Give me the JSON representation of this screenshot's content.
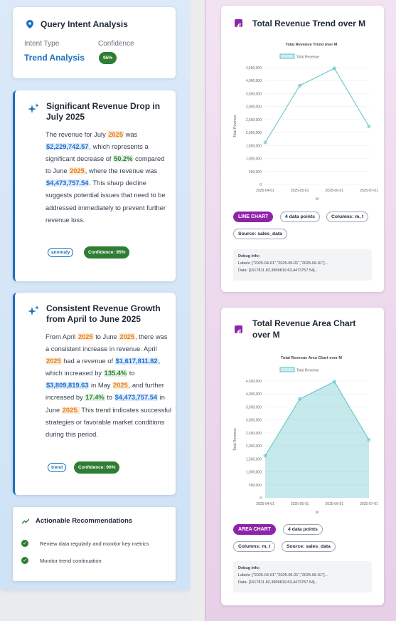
{
  "query_intent": {
    "title": "Query Intent Analysis",
    "intent_type_label": "Intent Type",
    "intent_type_value": "Trend Analysis",
    "confidence_label": "Confidence",
    "confidence_value": "95%"
  },
  "insight1": {
    "title": "Significant Revenue Drop in July 2025",
    "t1": "The revenue for July ",
    "h1": "2025",
    "t2": " was ",
    "h2": "$2,229,742.57",
    "t3": ", which represents a significant decrease of ",
    "h3": "50.2%",
    "t4": " compared to June ",
    "h4": "2025",
    "t5": ", where the revenue was ",
    "h5": "$4,473,757.54",
    "t6": ". This sharp decline suggests potential issues that need to be addressed immediately to prevent further revenue loss.",
    "tag": "anomaly",
    "confidence": "Confidence: 95%"
  },
  "insight2": {
    "title": "Consistent Revenue Growth from April to June 2025",
    "t1": "From April ",
    "h1": "2025",
    "t2": " to June ",
    "h2": "2025",
    "t3": ", there was a consistent increase in revenue. April ",
    "h3": "2025",
    "t4": " had a revenue of ",
    "h4": "$1,617,811.82",
    "t5": ", which increased by ",
    "h5": "135.4%",
    "t6": " to ",
    "h6": "$3,809,819.63",
    "t7": " in May ",
    "h7": "2025",
    "t8": ", and further increased by ",
    "h8": "17.4%",
    "t9": " to ",
    "h9": "$4,473,757.54",
    "t10": " in June ",
    "h10": "2025.",
    "t11": " This trend indicates successful strategies or favorable market conditions during this period.",
    "tag": "trend",
    "confidence": "Confidence: 90%"
  },
  "recommendations": {
    "title": "Actionable Recommendations",
    "items": [
      "Review data regularly and monitor key metrics",
      "Monitor trend continuation"
    ]
  },
  "chart1_card": {
    "title": "Total Revenue Trend over M",
    "tag_type": "LINE CHART",
    "tag_points": "4 data points",
    "tag_columns": "Columns: m, t",
    "tag_source": "Source: sales_data",
    "debug_title": "Debug Info:",
    "debug_labels": "Labels: [\"2025-04-01\",\"2025-05-01\",\"2025-06-01\"]...",
    "debug_data": "Data: [1617811.82,3809819.63,4473757.54]..."
  },
  "chart2_card": {
    "title": "Total Revenue Area Chart over M",
    "tag_type": "AREA CHART",
    "tag_points": "4 data points",
    "tag_columns": "Columns: m, t",
    "tag_source": "Source: sales_data",
    "debug_title": "Debug Info:",
    "debug_labels": "Labels: [\"2025-04-01\",\"2025-05-01\",\"2025-06-01\"]...",
    "debug_data": "Data: [1617811.82,3809819.63,4473757.54]..."
  },
  "chart_data": [
    {
      "type": "line",
      "title": "Total Revenue Trend over M",
      "legend": "Total Revenue",
      "xlabel": "M",
      "ylabel": "Total Revenue",
      "categories": [
        "2025-04-01",
        "2025-05-01",
        "2025-06-01",
        "2025-07-01"
      ],
      "series": [
        {
          "name": "Total Revenue",
          "values": [
            1617811.82,
            3809819.63,
            4473757.54,
            2229742.57
          ]
        }
      ],
      "ylim": [
        0,
        4500000
      ],
      "yticks": [
        "0",
        "500,000",
        "1,000,000",
        "1,500,000",
        "2,000,000",
        "2,500,000",
        "3,000,000",
        "3,500,000",
        "4,000,000",
        "4,500,000"
      ],
      "color": "#5bc0c7"
    },
    {
      "type": "area",
      "title": "Total Revenue Area Chart over M",
      "legend": "Total Revenue",
      "xlabel": "M",
      "ylabel": "Total Revenue",
      "categories": [
        "2025-04-01",
        "2025-05-01",
        "2025-06-01",
        "2025-07-01"
      ],
      "series": [
        {
          "name": "Total Revenue",
          "values": [
            1617811.82,
            3809819.63,
            4473757.54,
            2229742.57
          ]
        }
      ],
      "ylim": [
        0,
        4500000
      ],
      "yticks": [
        "0",
        "500,000",
        "1,000,000",
        "1,500,000",
        "2,000,000",
        "2,500,000",
        "3,000,000",
        "3,500,000",
        "4,000,000",
        "4,500,000"
      ],
      "color": "#5bc0c7"
    }
  ]
}
